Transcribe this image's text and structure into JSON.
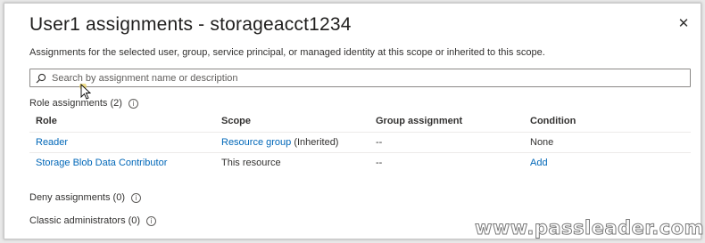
{
  "panel": {
    "title": "User1 assignments - storageacct1234",
    "close_icon": "close-icon",
    "description": "Assignments for the selected user, group, service principal, or managed identity at this scope or inherited to this scope."
  },
  "search": {
    "placeholder": "Search by assignment name or description",
    "value": "",
    "icon": "search-icon"
  },
  "role_assignments": {
    "label": "Role assignments (2)",
    "columns": [
      "Role",
      "Scope",
      "Group assignment",
      "Condition"
    ],
    "rows": [
      {
        "role": "Reader",
        "scope": "Resource group",
        "scope_suffix": " (Inherited)",
        "group_assignment": "--",
        "condition": "None"
      },
      {
        "role": "Storage Blob Data Contributor",
        "scope": "This resource",
        "scope_suffix": "",
        "group_assignment": "--",
        "condition": "Add"
      }
    ]
  },
  "deny_assignments": {
    "label": "Deny assignments (0)"
  },
  "classic_admins": {
    "label": "Classic administrators (0)"
  },
  "info_icon_glyph": "i",
  "watermark": "www.passleader.com",
  "colors": {
    "link": "#0067b8",
    "text": "#323130",
    "border": "#8a8886"
  }
}
